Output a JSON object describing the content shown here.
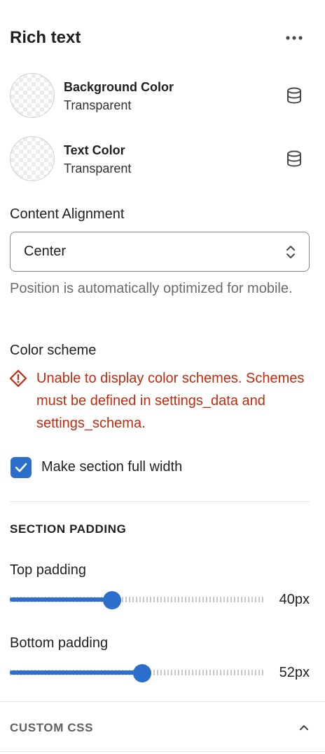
{
  "header": {
    "title": "Rich text",
    "more_icon": "more-horizontal-icon"
  },
  "colors": [
    {
      "name": "Background Color",
      "value": "Transparent",
      "icon": "database-icon"
    },
    {
      "name": "Text Color",
      "value": "Transparent",
      "icon": "database-icon"
    }
  ],
  "content_alignment": {
    "label": "Content Alignment",
    "selected": "Center",
    "help": "Position is automatically optimized for mobile."
  },
  "color_scheme": {
    "label": "Color scheme",
    "error": "Unable to display color schemes. Schemes must be defined in settings_data and settings_schema.",
    "error_color": "#c5280c"
  },
  "full_width": {
    "label": "Make section full width",
    "checked": true
  },
  "section_padding": {
    "heading": "SECTION PADDING",
    "top": {
      "label": "Top padding",
      "value_text": "40px",
      "value": 40,
      "max": 100
    },
    "bottom": {
      "label": "Bottom padding",
      "value_text": "52px",
      "value": 52,
      "max": 100
    }
  },
  "custom_css": {
    "heading": "CUSTOM CSS"
  },
  "theme": {
    "accent": "#2c6ecb"
  }
}
